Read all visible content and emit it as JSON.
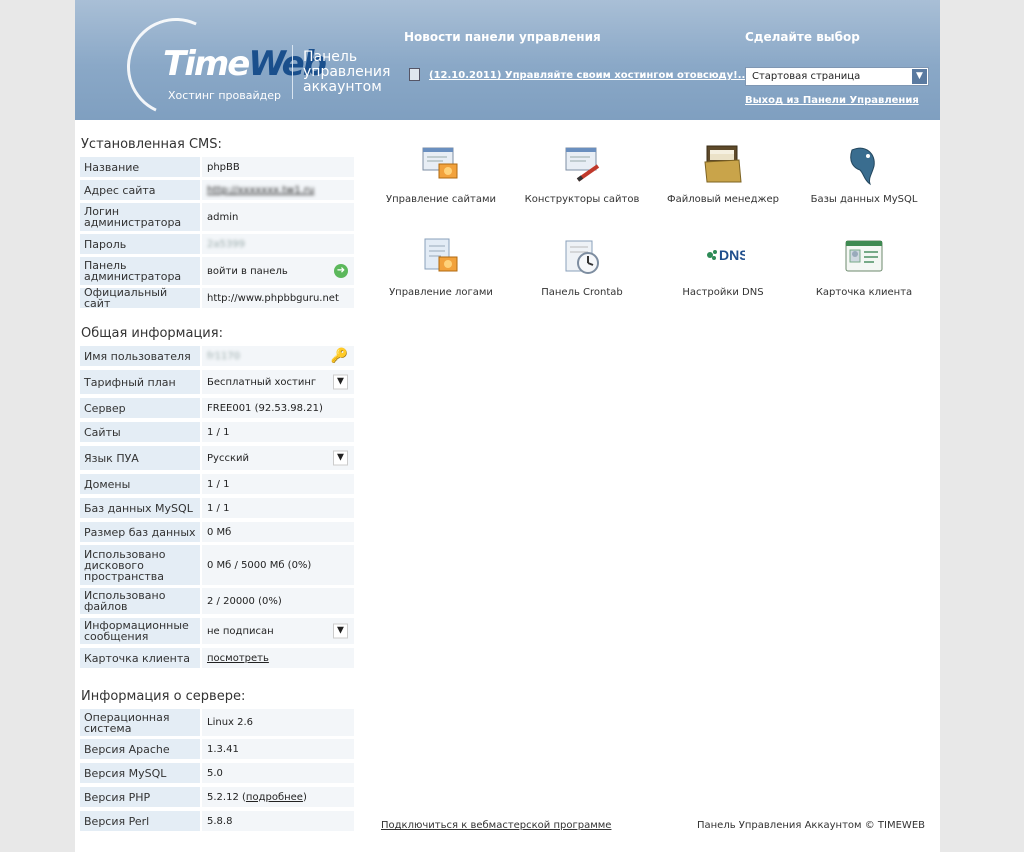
{
  "header": {
    "logo_time": "Time",
    "logo_web": "Web",
    "logo_sub": "Хостинг провайдер",
    "panel_title": "Панель управления аккаунтом",
    "news_title": "Новости панели управления",
    "news_link": "(12.10.2011) Управляйте своим хостингом отовсюду!...",
    "choice_title": "Сделайте выбор",
    "choice_selected": "Стартовая страница",
    "logout": "Выход из Панели Управления"
  },
  "cms": {
    "title": "Установленная CMS:",
    "rows": [
      {
        "label": "Название",
        "value": "phpBB"
      },
      {
        "label": "Адрес сайта",
        "value": "http://xxxxxxx.tw1.ru"
      },
      {
        "label": "Логин администратора",
        "value": "admin"
      },
      {
        "label": "Пароль",
        "value": "2a5399"
      },
      {
        "label": "Панель администратора",
        "value": "войти в панель"
      },
      {
        "label": "Официальный сайт",
        "value": "http://www.phpbbguru.net"
      }
    ]
  },
  "general": {
    "title": "Общая информация:",
    "rows": [
      {
        "label": "Имя пользователя",
        "value": "fr1170"
      },
      {
        "label": "Тарифный план",
        "value": "Бесплатный хостинг"
      },
      {
        "label": "Сервер",
        "value": "FREE001 (92.53.98.21)"
      },
      {
        "label": "Сайты",
        "value": "1 / 1"
      },
      {
        "label": "Язык ПУА",
        "value": "Русский"
      },
      {
        "label": "Домены",
        "value": "1 / 1"
      },
      {
        "label": "Баз данных MySQL",
        "value": "1 / 1"
      },
      {
        "label": "Размер баз данных",
        "value": "0 Мб"
      },
      {
        "label": "Использовано дискового пространства",
        "value": "0 Мб / 5000 Мб (0%)"
      },
      {
        "label": "Использовано файлов",
        "value": "2 / 20000 (0%)"
      },
      {
        "label": "Информационные сообщения",
        "value": "не подписан"
      },
      {
        "label": "Карточка клиента",
        "value": "посмотреть"
      }
    ]
  },
  "server": {
    "title": "Информация о сервере:",
    "rows": [
      {
        "label": "Операционная система",
        "value": "Linux 2.6"
      },
      {
        "label": "Версия Apache",
        "value": "1.3.41"
      },
      {
        "label": "Версия MySQL",
        "value": "5.0"
      },
      {
        "label": "Версия PHP",
        "value": "5.2.12",
        "extra_open": "(",
        "extra_link": "подробнее",
        "extra_close": ")"
      },
      {
        "label": "Версия Perl",
        "value": "5.8.8"
      }
    ]
  },
  "tools": [
    {
      "label": "Управление сайтами",
      "icon": "sites-management-icon"
    },
    {
      "label": "Конструкторы сайтов",
      "icon": "site-builder-icon"
    },
    {
      "label": "Файловый менеджер",
      "icon": "file-manager-icon"
    },
    {
      "label": "Базы данных MySQL",
      "icon": "mysql-icon"
    },
    {
      "label": "Управление логами",
      "icon": "logs-icon"
    },
    {
      "label": "Панель Crontab",
      "icon": "crontab-icon"
    },
    {
      "label": "Настройки DNS",
      "icon": "dns-icon",
      "icon_text": "DNS"
    },
    {
      "label": "Карточка клиента",
      "icon": "client-card-icon"
    }
  ],
  "footer": {
    "link": "Подключиться к вебмастерской программе",
    "copy": "Панель Управления Аккаунтом © TIMEWEB"
  },
  "colors": {
    "header": "#8aa8c7",
    "label_bg": "#e4edf5",
    "value_bg": "#f3f6f9"
  }
}
